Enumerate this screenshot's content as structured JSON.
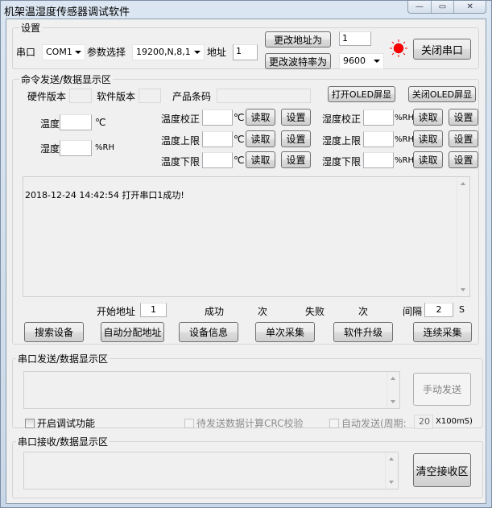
{
  "window": {
    "title": "机架温湿度传感器调试软件",
    "controls": {
      "minimize": "—",
      "maximize": "▭",
      "close": "✕"
    }
  },
  "settings": {
    "group_label": "设置",
    "port_label": "串口",
    "port_value": "COM1",
    "param_label": "参数选择",
    "param_value": "19200,N,8,1",
    "address_label": "地址",
    "address_value": "1",
    "change_address_button": "更改地址为",
    "new_address_value": "1",
    "change_baud_button": "更改波特率为",
    "new_baud_value": "9600",
    "status_led_color": "#ff0000",
    "close_port_button": "关闭串口"
  },
  "command": {
    "group_label": "命令发送/数据显示区",
    "hw_version_label": "硬件版本",
    "hw_version_value": "",
    "sw_version_label": "软件版本",
    "sw_version_value": "",
    "barcode_label": "产品条码",
    "barcode_value": "",
    "open_oled_button": "打开OLED屏显",
    "close_oled_button": "关闭OLED屏显",
    "temperature_label": "温度",
    "temperature_value": "",
    "temperature_unit": "℃",
    "humidity_label": "湿度",
    "humidity_value": "",
    "humidity_unit": "%RH",
    "temp_rows": [
      {
        "label": "温度校正",
        "value": "",
        "unit": "℃",
        "read": "读取",
        "set": "设置"
      },
      {
        "label": "温度上限",
        "value": "",
        "unit": "℃",
        "read": "读取",
        "set": "设置"
      },
      {
        "label": "温度下限",
        "value": "",
        "unit": "℃",
        "read": "读取",
        "set": "设置"
      }
    ],
    "hum_rows": [
      {
        "label": "湿度校正",
        "value": "",
        "unit": "%RH",
        "read": "读取",
        "set": "设置"
      },
      {
        "label": "湿度上限",
        "value": "",
        "unit": "%RH",
        "read": "读取",
        "set": "设置"
      },
      {
        "label": "湿度下限",
        "value": "",
        "unit": "%RH",
        "read": "读取",
        "set": "设置"
      }
    ],
    "log_lines": [
      "2018-12-24 14:42:54 打开串口1成功!"
    ],
    "start_address_label": "开始地址",
    "start_address_value": "1",
    "success_label": "成功",
    "success_count": "",
    "success_unit": "次",
    "fail_label": "失败",
    "fail_count": "",
    "fail_unit": "次",
    "interval_label": "间隔",
    "interval_value": "2",
    "interval_unit": "S",
    "buttons": [
      "搜索设备",
      "自动分配地址",
      "设备信息",
      "单次采集",
      "软件升级",
      "连续采集"
    ]
  },
  "serial_send": {
    "group_label": "串口发送/数据显示区",
    "text_value": "",
    "manual_send_button": "手动发送",
    "debug_checkbox_label": "开启调试功能",
    "debug_checked": false,
    "crc_checkbox_label": "待发送数据计算CRC校验",
    "crc_checked": false,
    "auto_send_label": "自动发送(周期:",
    "auto_send_checked": false,
    "period_value": "20",
    "period_unit": "X100mS)"
  },
  "serial_receive": {
    "group_label": "串口接收/数据显示区",
    "text_value": "",
    "clear_button": "清空接收区"
  }
}
